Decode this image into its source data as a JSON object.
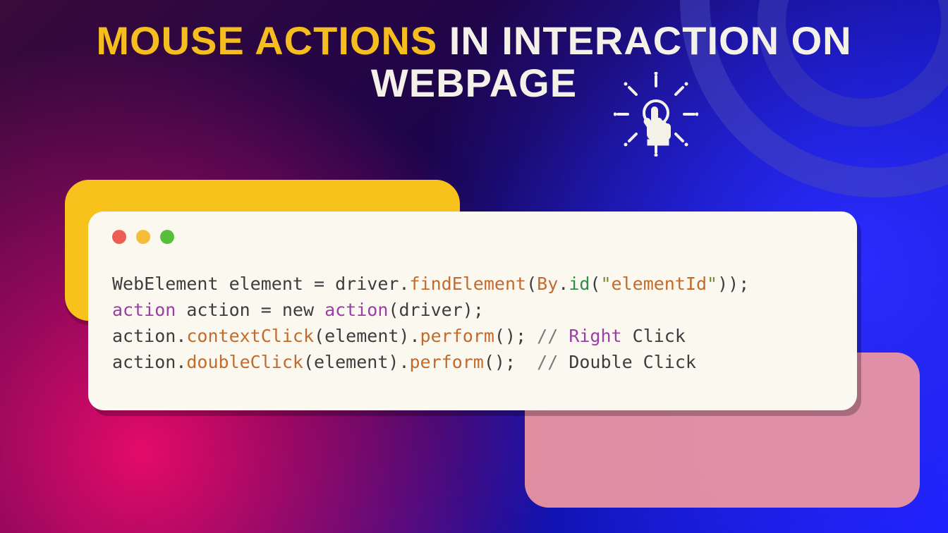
{
  "title": {
    "accent": "MOUSE ACTIONS",
    "rest_line1": " IN INTERACTION ON",
    "line2": "WEBPAGE"
  },
  "code": {
    "line1": {
      "type": "WebElement",
      "var": "element",
      "eq": "=",
      "driver": "driver",
      "dot1": ".",
      "findElement": "findElement",
      "paren_open": "(",
      "By": "By",
      "dot2": ".",
      "id": "id",
      "paren2_open": "(",
      "q1": "\"",
      "str": "elementId",
      "q2": "\"",
      "paren2_close": ")",
      "paren_close": ")",
      "semi": ";"
    },
    "line2": {
      "kw1": "action",
      "var": "action",
      "eq": "=",
      "new": "new",
      "kw2": "action",
      "paren_open": "(",
      "arg": "driver",
      "paren_close": ")",
      "semi": ";"
    },
    "line3": {
      "obj": "action",
      "dot1": ".",
      "fn1": "contextClick",
      "p1o": "(",
      "arg": "element",
      "p1c": ")",
      "dot2": ".",
      "fn2": "perform",
      "p2o": "(",
      "p2c": ")",
      "semi": ";",
      "gap": " ",
      "cmt_slash": "//",
      "cmt_sp": " ",
      "cmt_word1": "Right",
      "cmt_rest": " Click"
    },
    "line4": {
      "obj": "action",
      "dot1": ".",
      "fn1": "doubleClick",
      "p1o": "(",
      "arg": "element",
      "p1c": ")",
      "dot2": ".",
      "fn2": "perform",
      "p2o": "(",
      "p2c": ")",
      "semi": ";",
      "gap": "  ",
      "cmt_slash": "//",
      "cmt_rest": " Double Click"
    }
  }
}
